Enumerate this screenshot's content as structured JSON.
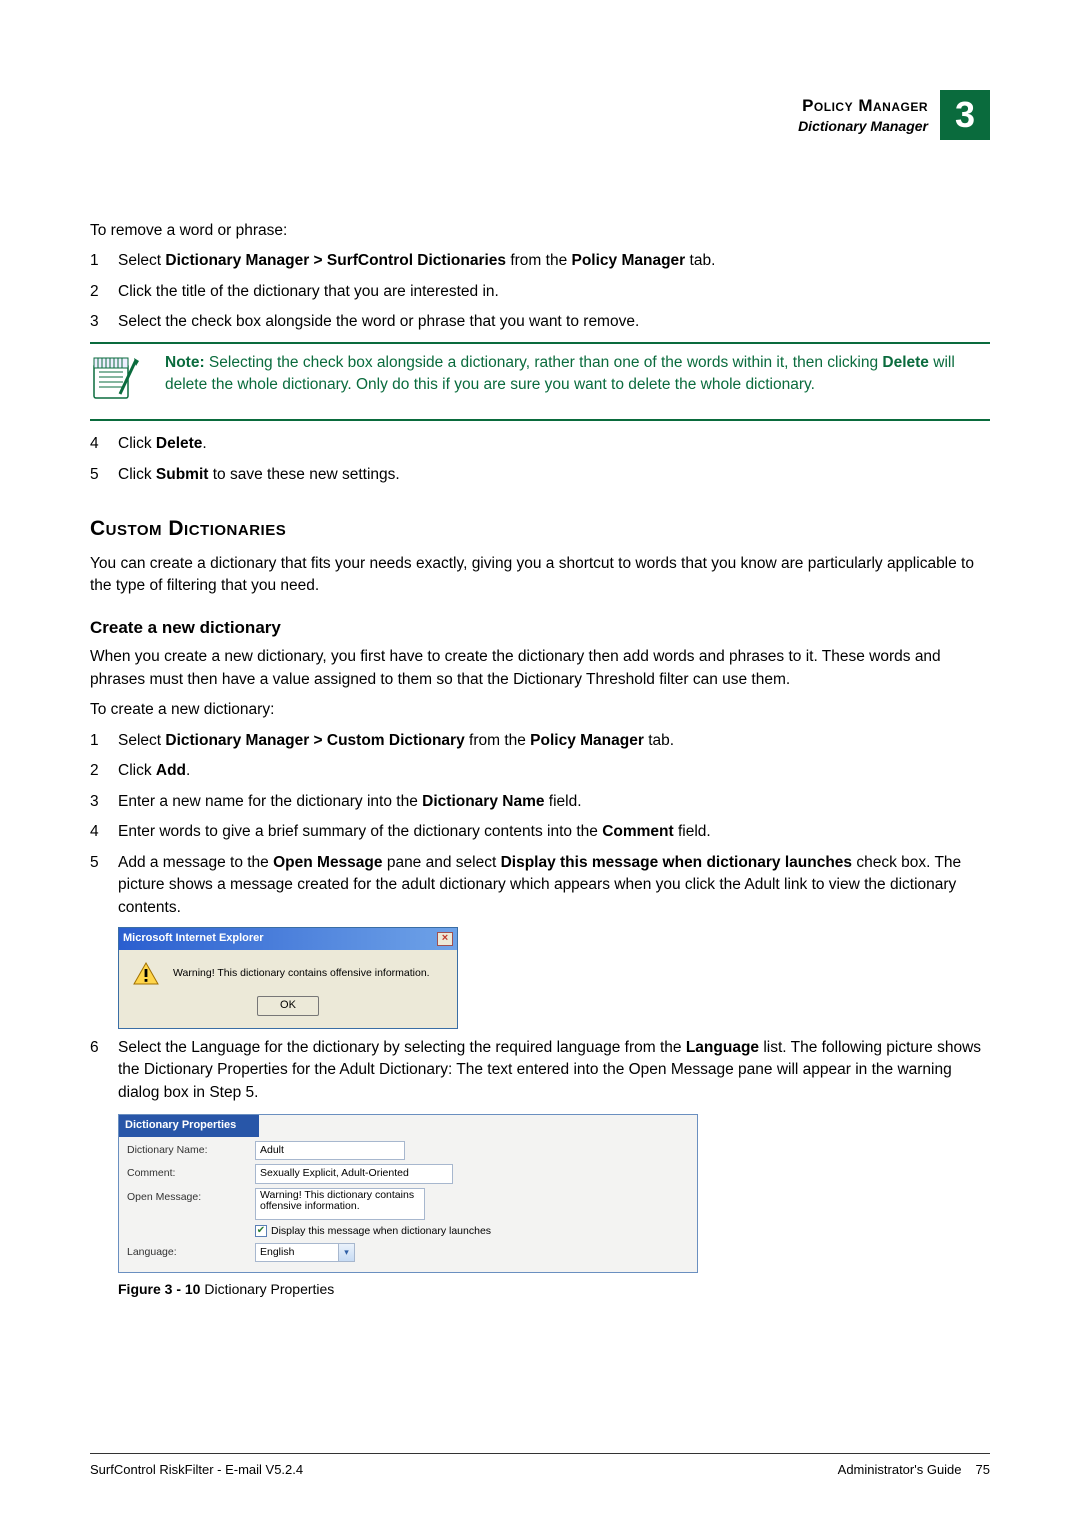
{
  "header": {
    "title": "Policy Manager",
    "subtitle": "Dictionary Manager",
    "chapter": "3"
  },
  "intro": "To remove a word or phrase:",
  "list1": {
    "i1": {
      "n": "1",
      "pre": "Select ",
      "b": "Dictionary Manager > SurfControl Dictionaries",
      "mid": " from the ",
      "b2": "Policy Manager",
      "post": " tab."
    },
    "i2": {
      "n": "2",
      "t": "Click the title of the dictionary that you are interested in."
    },
    "i3": {
      "n": "3",
      "t": "Select the check box alongside the word or phrase that you want to remove."
    }
  },
  "note": {
    "label": "Note:",
    "pre": "  Selecting the check box alongside a dictionary, rather than one of the words within it, then clicking ",
    "b": "Delete",
    "post": " will delete the whole dictionary. Only do this if you are sure you want to delete the whole dictionary."
  },
  "list1b": {
    "i4": {
      "n": "4",
      "pre": "Click ",
      "b": "Delete",
      "post": "."
    },
    "i5": {
      "n": "5",
      "pre": "Click ",
      "b": "Submit",
      "post": " to save these new settings."
    }
  },
  "h2": "Custom Dictionaries",
  "p2": "You can create a dictionary that fits your needs exactly, giving you a shortcut to words that you know are particularly applicable to the type of filtering that you need.",
  "h3": "Create a new dictionary",
  "p3": "When you create a new dictionary, you first have to create the dictionary then add words and phrases to it. These words and phrases must then have a value assigned to them so that the Dictionary Threshold filter can use them.",
  "p4": "To create a new dictionary:",
  "list2": {
    "i1": {
      "n": "1",
      "pre": "Select ",
      "b": "Dictionary Manager > Custom Dictionary",
      "mid": " from the ",
      "b2": "Policy Manager",
      "post": " tab."
    },
    "i2": {
      "n": "2",
      "pre": "Click ",
      "b": "Add",
      "post": "."
    },
    "i3": {
      "n": "3",
      "pre": "Enter a new name for the dictionary into the ",
      "b": "Dictionary Name",
      "post": " field."
    },
    "i4": {
      "n": "4",
      "pre": "Enter words to give a brief summary of the dictionary contents into the ",
      "b": "Comment",
      "post": " field."
    },
    "i5": {
      "n": "5",
      "pre": "Add a message to the ",
      "b": "Open Message",
      "mid": " pane and select ",
      "b2": "Display this message when dictionary launches",
      "post": " check box. The picture shows a message created for the adult dictionary which appears when you click the Adult link to view the dictionary contents."
    },
    "i6": {
      "n": "6",
      "pre": "Select the Language for the dictionary by selecting the required language from the ",
      "b": "Language",
      "post": " list. The following picture shows the Dictionary Properties for the Adult Dictionary: The text entered into the Open Message pane will appear in the warning dialog box in Step 5."
    }
  },
  "dialog": {
    "title": "Microsoft Internet Explorer",
    "close": "×",
    "msg": "Warning! This dictionary contains offensive information.",
    "ok": "OK"
  },
  "props": {
    "panel_title": "Dictionary Properties",
    "name_label": "Dictionary Name:",
    "name_value": "Adult",
    "comment_label": "Comment:",
    "comment_value": "Sexually Explicit, Adult-Oriented",
    "open_label": "Open Message:",
    "open_value": "Warning! This dictionary contains offensive information.",
    "checkbox_label": "Display this message when dictionary launches",
    "lang_label": "Language:",
    "lang_value": "English"
  },
  "fig": {
    "label": "Figure 3 - 10 ",
    "caption": "Dictionary Properties"
  },
  "footer": {
    "left": "SurfControl RiskFilter - E-mail V5.2.4",
    "right": "Administrator's Guide",
    "page": "75"
  }
}
